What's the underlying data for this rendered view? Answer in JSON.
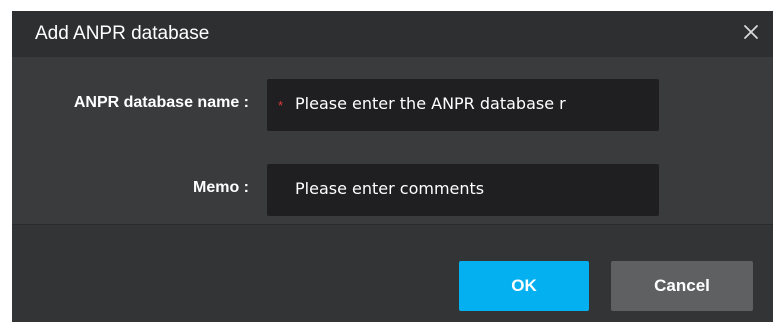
{
  "dialog": {
    "title": "Add ANPR database",
    "close_icon": "close-icon"
  },
  "form": {
    "db_name": {
      "label": "ANPR database name :",
      "required_mark": "*",
      "placeholder": "Please enter the ANPR database r"
    },
    "memo": {
      "label": "Memo :",
      "placeholder": "Please enter comments"
    }
  },
  "buttons": {
    "ok": "OK",
    "cancel": "Cancel"
  },
  "colors": {
    "accent": "#05b0f1",
    "required": "#e23a3a",
    "dialog_bg": "#333436"
  }
}
